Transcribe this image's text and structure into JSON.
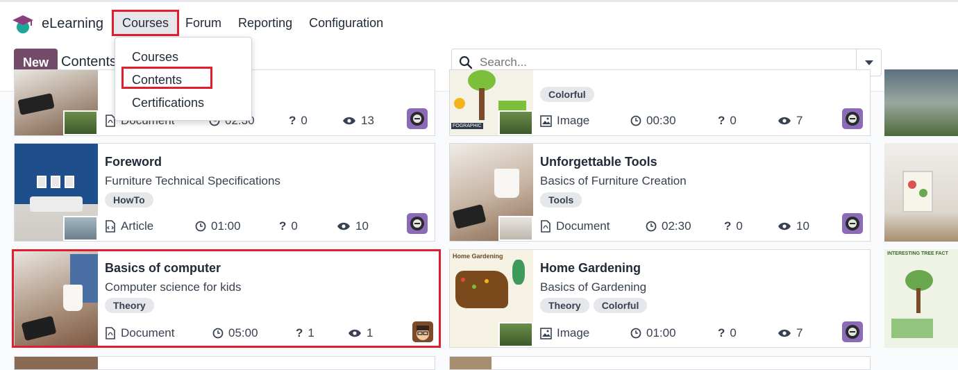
{
  "app": {
    "name": "eLearning"
  },
  "menu": {
    "items": [
      "Courses",
      "Forum",
      "Reporting",
      "Configuration"
    ]
  },
  "dropdown": {
    "items": [
      "Courses",
      "Contents",
      "Certifications"
    ]
  },
  "control": {
    "new_label": "New",
    "breadcrumb": "Contents",
    "search_placeholder": "Search..."
  },
  "cards": [
    {
      "tags": [],
      "type": "Document",
      "duration": "02:30",
      "questions": "0",
      "views": "13"
    },
    {
      "tags": [
        "Colorful"
      ],
      "type": "Image",
      "duration": "00:30",
      "questions": "0",
      "views": "7"
    },
    {
      "title": "Foreword",
      "subtitle": "Furniture Technical Specifications",
      "tags": [
        "HowTo"
      ],
      "type": "Article",
      "duration": "01:00",
      "questions": "0",
      "views": "10"
    },
    {
      "title": "Unforgettable Tools",
      "subtitle": "Basics of Furniture Creation",
      "tags": [
        "Tools"
      ],
      "type": "Document",
      "duration": "02:30",
      "questions": "0",
      "views": "10"
    },
    {
      "title": "Basics of computer",
      "subtitle": "Computer science for kids",
      "tags": [
        "Theory"
      ],
      "type": "Document",
      "duration": "05:00",
      "questions": "1",
      "views": "1"
    },
    {
      "title": "Home Gardening",
      "subtitle": "Basics of Gardening",
      "tags": [
        "Theory",
        "Colorful"
      ],
      "type": "Image",
      "duration": "01:00",
      "questions": "0",
      "views": "7"
    }
  ],
  "thumb_labels": {
    "home_gardening": "Home Gardening",
    "interesting_tree": "INTERESTING TREE FACT",
    "infographic": "FOGRAPHIC"
  },
  "colors": {
    "brand": "#714b67",
    "highlight": "#e11d2e",
    "tag_bg": "#e5e7eb"
  }
}
